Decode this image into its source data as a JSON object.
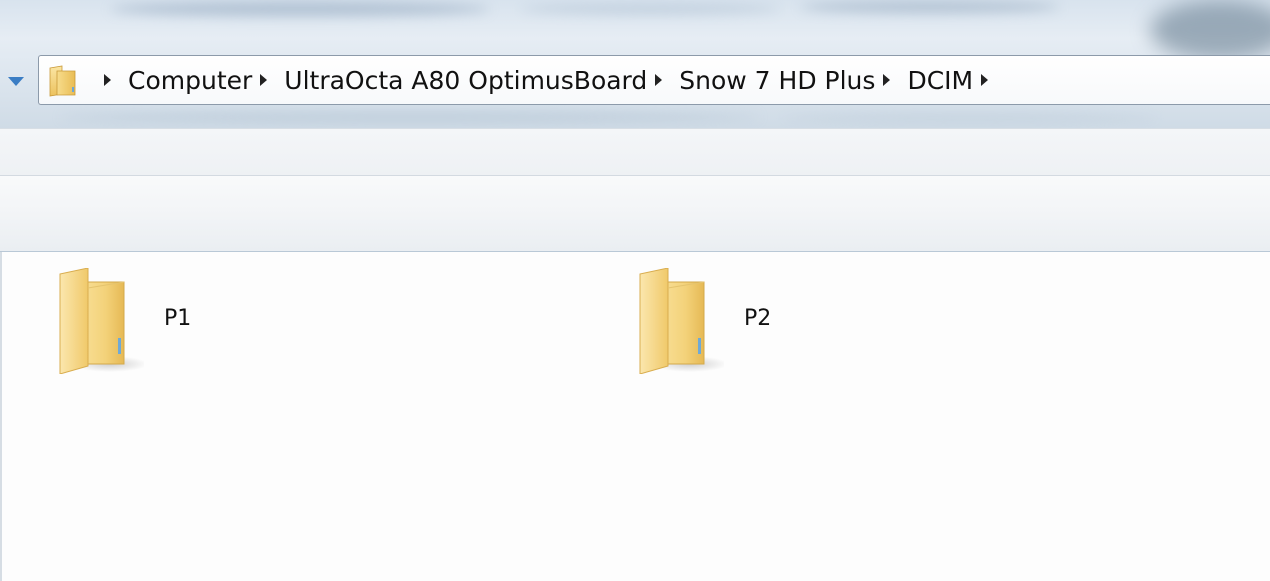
{
  "address_bar": {
    "breadcrumbs": [
      {
        "label": "Computer"
      },
      {
        "label": "UltraOcta A80 OptimusBoard"
      },
      {
        "label": "Snow 7 HD Plus"
      },
      {
        "label": "DCIM"
      }
    ],
    "icons": {
      "location": "folder-icon",
      "history_dropdown": "chevron-down-icon",
      "separator": "chevron-right-icon"
    }
  },
  "content": {
    "items": [
      {
        "name": "P1",
        "type": "folder",
        "icon": "folder-icon"
      },
      {
        "name": "P2",
        "type": "folder",
        "icon": "folder-icon"
      }
    ]
  },
  "colors": {
    "accent": "#3b7dc4",
    "folder_yellow": "#f3d27a",
    "background": "#fdfdfd"
  }
}
